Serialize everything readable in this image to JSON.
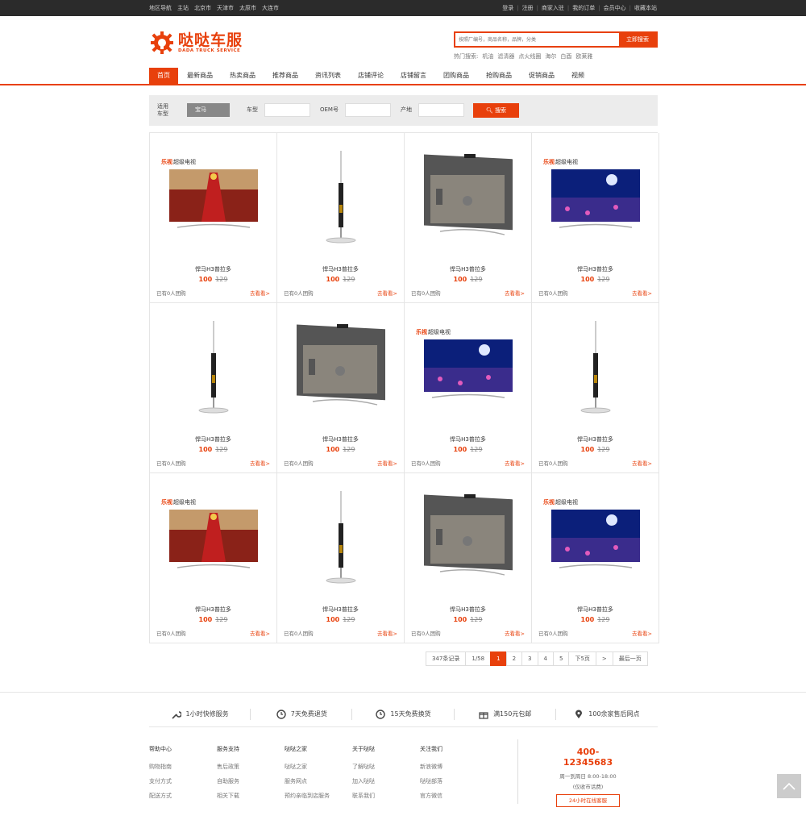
{
  "topbar": {
    "left": [
      "地区导航",
      "主站",
      "北京市",
      "天津市",
      "太原市",
      "大连市"
    ],
    "right": [
      "登录",
      "注册",
      "商家入驻",
      "我的订单",
      "会员中心",
      "收藏本站"
    ]
  },
  "logo": {
    "cn": "哒哒车服",
    "en": "DADA TRUCK SERVICE"
  },
  "search": {
    "placeholder": "按照厂编号，商品名称，品牌，分类",
    "button": "立即搜索"
  },
  "hot": {
    "label": "热门搜索:",
    "items": [
      "机油",
      "滤清器",
      "点火线圈",
      "海尔",
      "白酉",
      "欧莱雅"
    ]
  },
  "nav": [
    "首页",
    "最新商品",
    "热卖商品",
    "推荐商品",
    "资讯列表",
    "店铺评论",
    "店铺留言",
    "团购商品",
    "抢购商品",
    "促销商品",
    "视频"
  ],
  "filter": {
    "label": "适用车型",
    "brand": "宝马",
    "car_type": "车型",
    "oem": "OEM号",
    "origin": "产地",
    "search_btn": "搜索"
  },
  "product": {
    "name": "悍马H3普拉多",
    "price": "100",
    "old_price": "129",
    "group": "已有0人团购",
    "go": "去看看>"
  },
  "pager": [
    "347条记录",
    "1/58",
    "1",
    "2",
    "3",
    "4",
    "5",
    "下5页",
    ">",
    "最后一页"
  ],
  "services": [
    "1小时快修服务",
    "7天免费退货",
    "15天免费换货",
    "满150元包邮",
    "100余家售后网点"
  ],
  "footer_cols": [
    {
      "title": "帮助中心",
      "links": [
        "购物指南",
        "支付方式",
        "配送方式"
      ]
    },
    {
      "title": "服务支持",
      "links": [
        "售后政策",
        "自助服务",
        "相关下载"
      ]
    },
    {
      "title": "哒哒之家",
      "links": [
        "哒哒之家",
        "服务网点",
        "预约亲临到店服务"
      ]
    },
    {
      "title": "关于哒哒",
      "links": [
        "了解哒哒",
        "加入哒哒",
        "联系我们"
      ]
    },
    {
      "title": "关注我们",
      "links": [
        "新浪微博",
        "哒哒部落",
        "官方微信"
      ]
    }
  ],
  "contact": {
    "tel": "400-12345683",
    "hours": "周一到周日 8:00-18:00",
    "note": "(仅收市话费)",
    "btn": "24小时在线客服"
  },
  "colors": {
    "accent": "#e8400c",
    "topbar": "#2b2b2b"
  }
}
